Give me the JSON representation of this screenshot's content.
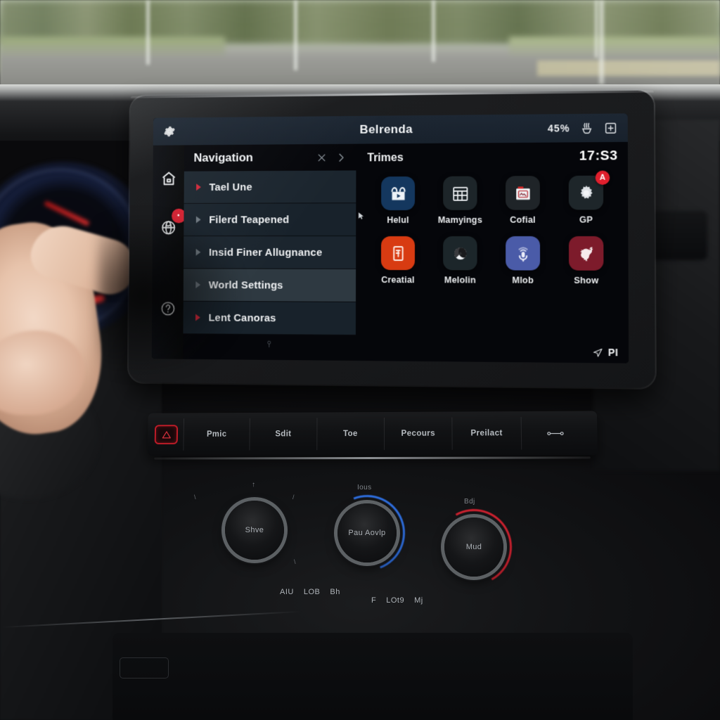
{
  "status_bar": {
    "gear_icon": "gear-icon",
    "title": "Belrenda",
    "battery": "45%",
    "seat_icon": "seat-heater-icon",
    "plus_icon": "add-box-icon"
  },
  "rail": {
    "items": [
      {
        "icon": "home-icon",
        "badge": null
      },
      {
        "icon": "globe-media-icon",
        "badge": "•"
      },
      {
        "icon": "help-icon",
        "badge": null
      }
    ]
  },
  "nav_panel": {
    "title": "Navigation",
    "close_icon": "close-icon",
    "expand_icon": "chevron-right-icon",
    "footer_icon": "usb-icon",
    "items": [
      {
        "label": "Tael Une",
        "caret": "red",
        "state": "normal"
      },
      {
        "label": "Filerd Teapened",
        "caret": "grey",
        "state": "normal"
      },
      {
        "label": "Insid Finer Allugnance",
        "caret": "grey",
        "state": "normal"
      },
      {
        "label": "World Settings",
        "caret": "grey",
        "state": "active"
      },
      {
        "label": "Lent Canoras",
        "caret": "red",
        "state": "normal"
      }
    ]
  },
  "app_panel": {
    "title": "Trimes",
    "clock": "17:S3",
    "footer": {
      "icon": "navigation-arrow-icon",
      "text": "PI"
    },
    "apps": [
      {
        "label": "Helul",
        "icon": "media-play-icon",
        "color": "#14375e",
        "badge": null
      },
      {
        "label": "Mamyings",
        "icon": "calendar-icon",
        "color": "#1d2529",
        "badge": null
      },
      {
        "label": "Cofial",
        "icon": "document-icon",
        "color": "#1f2428",
        "badge": null
      },
      {
        "label": "GP",
        "icon": "gear-icon",
        "color": "#1e262a",
        "badge": "A"
      },
      {
        "label": "Creatial",
        "icon": "book-icon",
        "color": "#d83b12",
        "badge": null
      },
      {
        "label": "Melolin",
        "icon": "disc-icon",
        "color": "#1c262a",
        "badge": null
      },
      {
        "label": "Mlob",
        "icon": "mic-icon",
        "color": "#4a5ba8",
        "badge": null
      },
      {
        "label": "Show",
        "icon": "horse-icon",
        "color": "#7d1b2b",
        "badge": null
      }
    ]
  },
  "button_bar": {
    "hazard_icon": "hazard-triangle-icon",
    "buttons": [
      {
        "label": "Pmic"
      },
      {
        "label": "Sdit"
      },
      {
        "label": "Toe"
      },
      {
        "label": "Pecours"
      },
      {
        "label": "Preilact"
      },
      {
        "label": "",
        "icon": "seat-adjust-icon"
      }
    ]
  },
  "climate": {
    "left_knob": {
      "label": "Shve",
      "caption": "↑"
    },
    "center_knob": {
      "label": "Pau Aovlp",
      "caption": "Ious"
    },
    "right_knob": {
      "label": "Mud",
      "caption": "Bdj"
    },
    "left_buttons": [
      "AIU",
      "LOB",
      "Bh"
    ],
    "right_buttons": [
      "F",
      "LOt9",
      "Mj"
    ]
  },
  "colors": {
    "accent_red": "#d2283a",
    "screen_bg": "#05060a",
    "panel_bg": "#1b252e",
    "active_row": "#2e3941",
    "status_bar": "#1d2733"
  }
}
